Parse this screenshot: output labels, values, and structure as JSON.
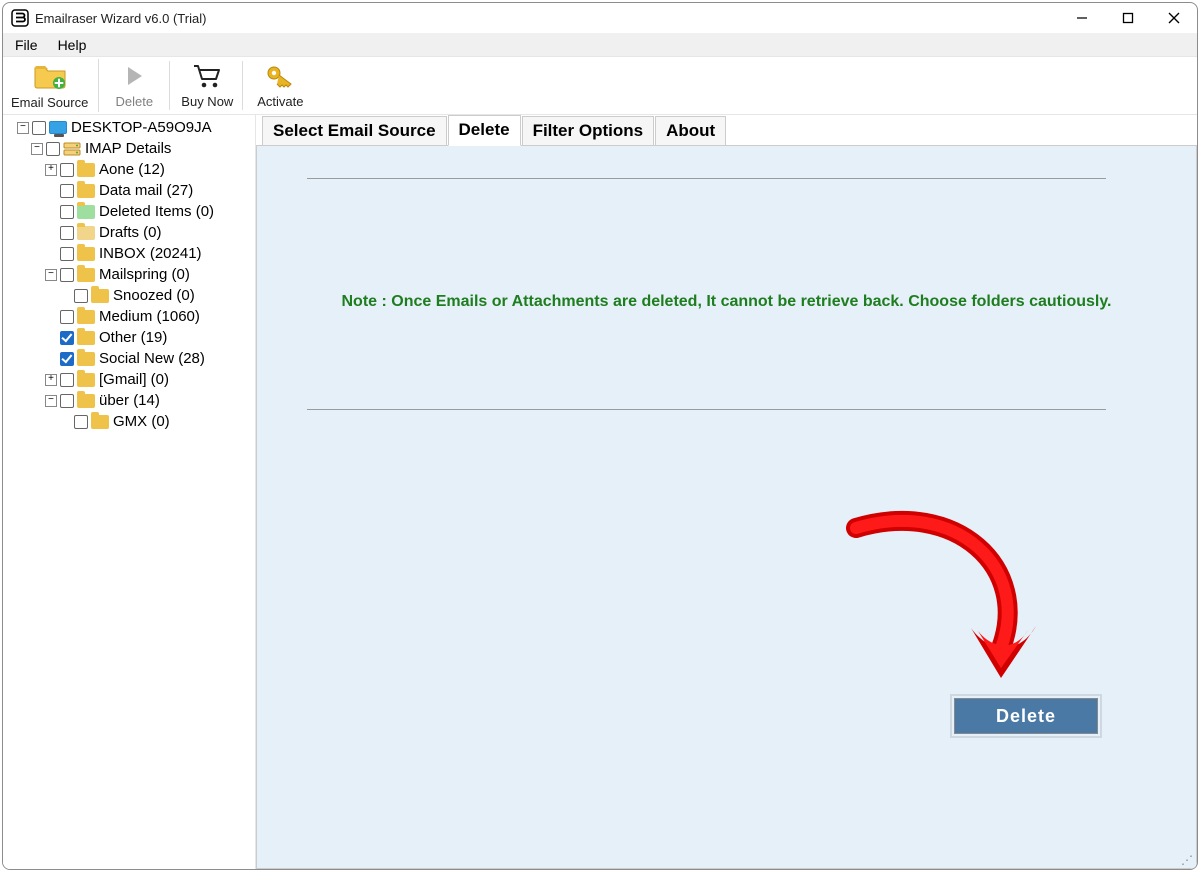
{
  "window": {
    "title": "Emailraser Wizard v6.0 (Trial)"
  },
  "menu": {
    "file": "File",
    "help": "Help"
  },
  "toolbar": {
    "email_source": "Email Source",
    "delete": "Delete",
    "buy_now": "Buy Now",
    "activate": "Activate"
  },
  "tabs": {
    "source": "Select Email Source",
    "delete": "Delete",
    "filter": "Filter Options",
    "about": "About",
    "active": "Delete"
  },
  "note": "Note : Once Emails or Attachments are deleted, It cannot be retrieve back. Choose folders cautiously.",
  "action": {
    "delete_button": "Delete"
  },
  "tree": {
    "root": "DESKTOP-A59O9JA",
    "imap": "IMAP Details",
    "items": [
      {
        "label": "Aone (12)",
        "checked": false,
        "expander": "plus",
        "depth": 3,
        "icon": "folder"
      },
      {
        "label": "Data mail (27)",
        "checked": false,
        "expander": "none",
        "depth": 3,
        "icon": "folder"
      },
      {
        "label": "Deleted Items (0)",
        "checked": false,
        "expander": "none",
        "depth": 3,
        "icon": "recycle"
      },
      {
        "label": "Drafts (0)",
        "checked": false,
        "expander": "none",
        "depth": 3,
        "icon": "drafts"
      },
      {
        "label": "INBOX (20241)",
        "checked": false,
        "expander": "none",
        "depth": 3,
        "icon": "folder"
      },
      {
        "label": "Mailspring (0)",
        "checked": false,
        "expander": "minus",
        "depth": 3,
        "icon": "folder"
      },
      {
        "label": "Snoozed (0)",
        "checked": false,
        "expander": "none",
        "depth": 4,
        "icon": "folder"
      },
      {
        "label": "Medium (1060)",
        "checked": false,
        "expander": "none",
        "depth": 3,
        "icon": "folder"
      },
      {
        "label": "Other (19)",
        "checked": true,
        "expander": "none",
        "depth": 3,
        "icon": "folder"
      },
      {
        "label": "Social New (28)",
        "checked": true,
        "expander": "none",
        "depth": 3,
        "icon": "folder"
      },
      {
        "label": "[Gmail] (0)",
        "checked": false,
        "expander": "plus",
        "depth": 3,
        "icon": "folder"
      },
      {
        "label": "über (14)",
        "checked": false,
        "expander": "minus",
        "depth": 3,
        "icon": "folder"
      },
      {
        "label": "GMX (0)",
        "checked": false,
        "expander": "none",
        "depth": 4,
        "icon": "folder"
      }
    ]
  }
}
